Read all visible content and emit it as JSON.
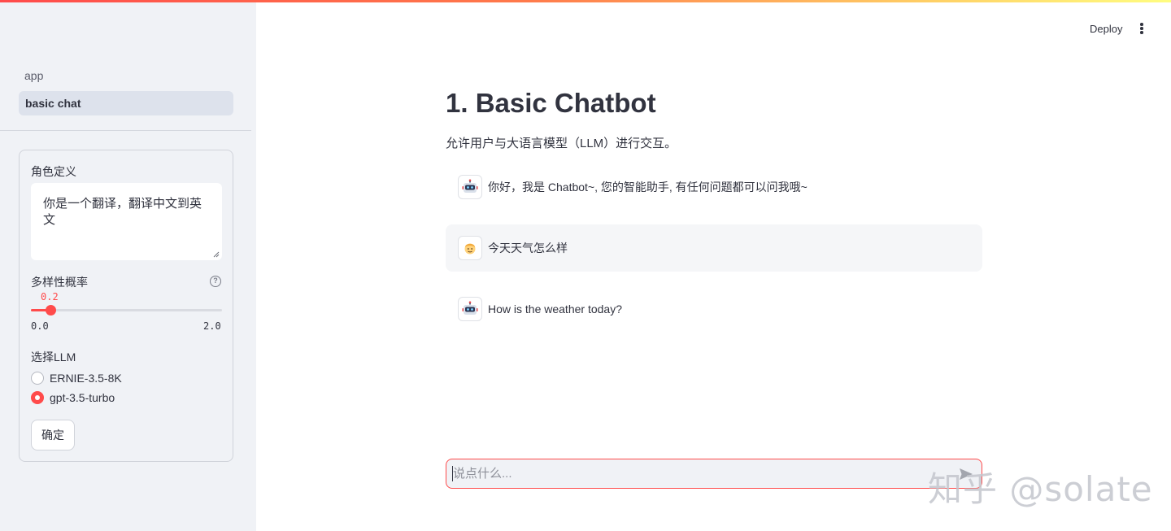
{
  "sidebar": {
    "nav": {
      "app_label": "app",
      "active_label": "basic chat"
    },
    "role": {
      "label": "角色定义",
      "value_line1": "你是一个翻译，翻译中文到英",
      "value_line2": "文"
    },
    "temperature": {
      "label": "多样性概率",
      "value": 0.2,
      "value_text": "0.2",
      "min": 0.0,
      "max": 2.0,
      "min_text": "0.0",
      "max_text": "2.0",
      "help_icon": "help-circle-icon"
    },
    "llm": {
      "label": "选择LLM",
      "options": [
        {
          "label": "ERNIE-3.5-8K",
          "selected": false
        },
        {
          "label": "gpt-3.5-turbo",
          "selected": true
        }
      ]
    },
    "confirm_label": "确定"
  },
  "header": {
    "deploy_label": "Deploy",
    "menu_icon": "kebab-menu-icon"
  },
  "main": {
    "title": "1. Basic Chatbot",
    "description": "允许用户与大语言模型（LLM）进行交互。",
    "messages": [
      {
        "role": "assistant",
        "avatar": "robot-icon",
        "text": "你好，我是 Chatbot~, 您的智能助手, 有任何问题都可以问我哦~"
      },
      {
        "role": "user",
        "avatar": "user-face-icon",
        "text": "今天天气怎么样"
      },
      {
        "role": "assistant",
        "avatar": "robot-icon",
        "text": "How is the weather today?"
      }
    ],
    "chat_input": {
      "placeholder": "说点什么...",
      "send_icon": "send-icon"
    }
  },
  "watermark": "知乎 @solate",
  "colors": {
    "accent": "#ff4b4b",
    "sidebar_bg": "#f0f2f6",
    "text": "#31333f"
  }
}
